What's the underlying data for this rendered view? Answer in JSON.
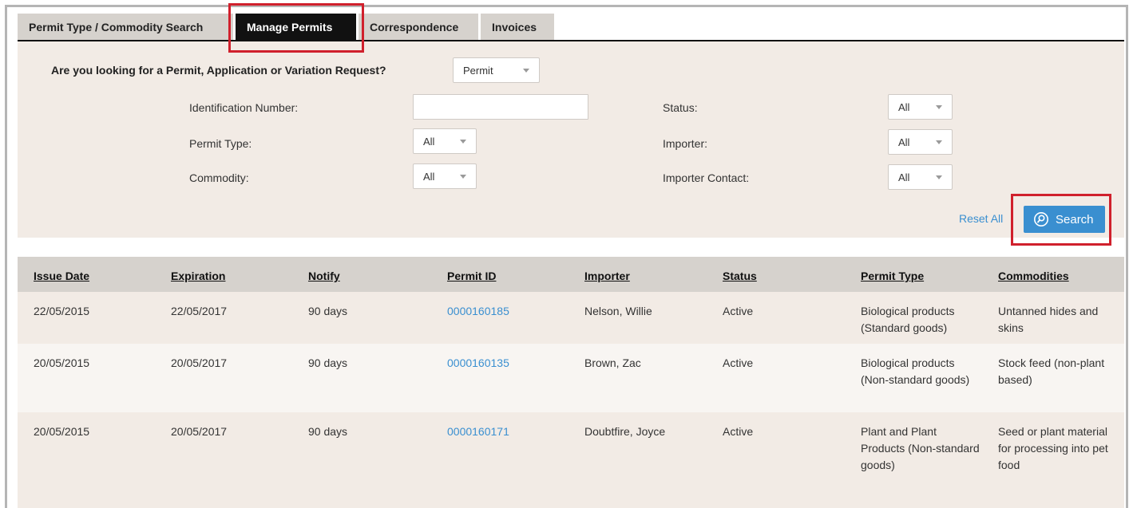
{
  "tabs": [
    {
      "label": "Permit Type / Commodity Search",
      "active": false
    },
    {
      "label": "Manage Permits",
      "active": true
    },
    {
      "label": "Correspondence",
      "active": false
    },
    {
      "label": "Invoices",
      "active": false
    }
  ],
  "filters": {
    "question": "Are you looking for a Permit, Application or Variation Request?",
    "request_type": "Permit",
    "identification_label": "Identification Number:",
    "identification_value": "",
    "permit_type_label": "Permit Type:",
    "permit_type_value": "All",
    "commodity_label": "Commodity:",
    "commodity_value": "All",
    "status_label": "Status:",
    "status_value": "All",
    "importer_label": "Importer:",
    "importer_value": "All",
    "importer_contact_label": "Importer Contact:",
    "importer_contact_value": "All",
    "reset_label": "Reset All",
    "search_label": "Search"
  },
  "table": {
    "headers": [
      "Issue Date",
      "Expiration",
      "Notify",
      "Permit ID",
      "Importer",
      "Status",
      "Permit Type",
      "Commodities"
    ],
    "rows": [
      {
        "issue_date": "22/05/2015",
        "expiration": "22/05/2017",
        "notify": "90 days",
        "permit_id": "0000160185",
        "importer": "Nelson, Willie",
        "status": "Active",
        "permit_type": "Biological products (Standard goods)",
        "commodities": "Untanned hides and skins"
      },
      {
        "issue_date": "20/05/2015",
        "expiration": "20/05/2017",
        "notify": "90 days",
        "permit_id": "0000160135",
        "importer": "Brown, Zac",
        "status": "Active",
        "permit_type": "Biological products (Non-standard goods)",
        "commodities": "Stock feed (non-plant based)"
      },
      {
        "issue_date": "20/05/2015",
        "expiration": "20/05/2017",
        "notify": "90 days",
        "permit_id": "0000160171",
        "importer": "Doubtfire, Joyce",
        "status": "Active",
        "permit_type": "Plant and Plant Products (Non-standard goods)",
        "commodities": "Seed or plant material for processing into pet food"
      }
    ]
  },
  "colors": {
    "panel_bg": "#f2ebe5",
    "header_bg": "#d6d2cd",
    "link": "#3a8fd0",
    "highlight": "#d0202c",
    "active_tab": "#111111"
  }
}
